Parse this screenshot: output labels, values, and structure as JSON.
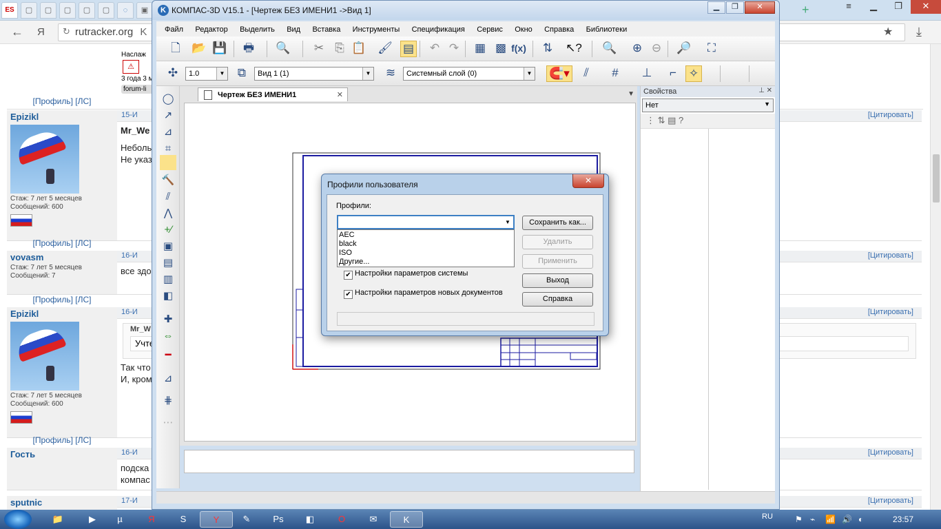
{
  "browser": {
    "back": "←",
    "yandex_logo": "Я",
    "url": "rutracker.org",
    "url_tail": "K",
    "star": "★",
    "download": "⤓"
  },
  "forum": {
    "top_fragment": {
      "line1": "Наслаж",
      "line2": "3 года 3 м",
      "tag": "forum-li",
      "links": "[Профиль] [ЛС]"
    },
    "posts": [
      {
        "nick": "Epizikl",
        "date": "15-И",
        "quote": "[Цитировать]",
        "author_ref": "Mr_We",
        "text1": "Неболь",
        "text2": "Не указ",
        "stazh": "Стаж: 7 лет 5 месяцев",
        "msgs": "Сообщений: 600",
        "links": "[Профиль] [ЛС]"
      },
      {
        "nick": "vovasm",
        "date": "16-И",
        "quote": "[Цитировать]",
        "text1": "все здо",
        "stazh": "Стаж: 7 лет 5 месяцев",
        "msgs": "Сообщений: 7",
        "links": "[Профиль] [ЛС]"
      },
      {
        "nick": "Epizikl",
        "date": "16-И",
        "quote": "[Цитировать]",
        "author_ref": "Mr_W",
        "quote_box": "Учте",
        "text1": "Так что",
        "text2": "И, кром",
        "stazh": "Стаж: 7 лет 5 месяцев",
        "msgs": "Сообщений: 600",
        "links": "[Профиль] [ЛС]"
      },
      {
        "nick": "Гость",
        "date": "16-И",
        "quote": "[Цитировать]",
        "text1": "подска",
        "text2": "компас"
      },
      {
        "nick": "sputnic",
        "date": "17-И",
        "quote": "[Цитировать]"
      }
    ]
  },
  "kompas": {
    "title": "КОМПАС-3D V15.1 - [Чертеж БЕЗ ИМЕНИ1 ->Вид 1]",
    "menu": [
      "Файл",
      "Редактор",
      "Выделить",
      "Вид",
      "Вставка",
      "Инструменты",
      "Спецификация",
      "Сервис",
      "Окно",
      "Справка",
      "Библиотеки"
    ],
    "scale_value": "1.0",
    "view_value": "Вид 1 (1)",
    "layer_value": "Системный слой (0)",
    "doc_tab": "Чертеж БЕЗ ИМЕНИ1",
    "props_title": "Свойства",
    "props_combo": "Нет"
  },
  "dialog": {
    "title": "Профили пользователя",
    "close": "✕",
    "profiles_label": "Профили:",
    "combo_value": "",
    "options": [
      "AEC",
      "black",
      "ISO",
      "Другие..."
    ],
    "check_system": "Настройки параметров системы",
    "check_newdocs": "Настройки параметров новых документов",
    "btn_save": "Сохранить как...",
    "btn_delete": "Удалить",
    "btn_apply": "Применить",
    "btn_exit": "Выход",
    "btn_help": "Справка"
  },
  "taskbar": {
    "lang": "RU",
    "time": "23:57"
  },
  "colors": {
    "accent": "#3c7fc4",
    "drawing_frame": "#1a1aa0",
    "axis_red": "#d01010"
  }
}
